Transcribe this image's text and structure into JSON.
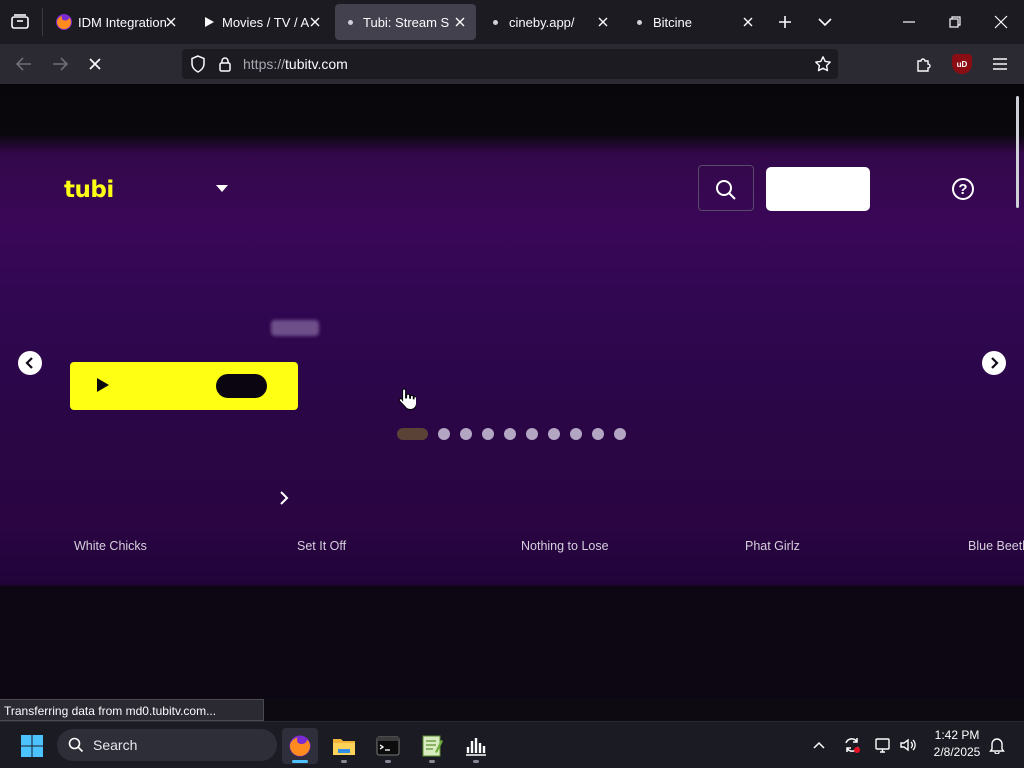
{
  "browser": {
    "tabs": [
      {
        "title": "IDM Integration",
        "icon": "firefox-icon",
        "active": false
      },
      {
        "title": "Movies / TV / Anime",
        "icon": "play-icon",
        "active": false
      },
      {
        "title": "Tubi: Stream Supported",
        "icon": "loading-dot-icon",
        "active": true
      },
      {
        "title": "cineby.app/",
        "icon": "loading-dot-icon",
        "active": false
      },
      {
        "title": "Bitcine",
        "icon": "loading-dot-icon",
        "active": false
      }
    ],
    "url": {
      "scheme": "https://",
      "host": "tubitv.com"
    },
    "ublock_label": "uD"
  },
  "page": {
    "logo": "tubi",
    "help_label": "?",
    "carousel_pages": 10,
    "carousel_active_index": 0,
    "movies": [
      "White Chicks",
      "Set It Off",
      "Nothing to Lose",
      "Phat Girlz",
      "Blue Beetle"
    ]
  },
  "status_text": "Transferring data from md0.tubitv.com...",
  "taskbar": {
    "search_label": "Search",
    "time": "1:42 PM",
    "date": "2/8/2025",
    "accent": "#4cc2ff"
  },
  "colors": {
    "tubi_yellow": "#ffff13",
    "purple": "#3a0758"
  }
}
